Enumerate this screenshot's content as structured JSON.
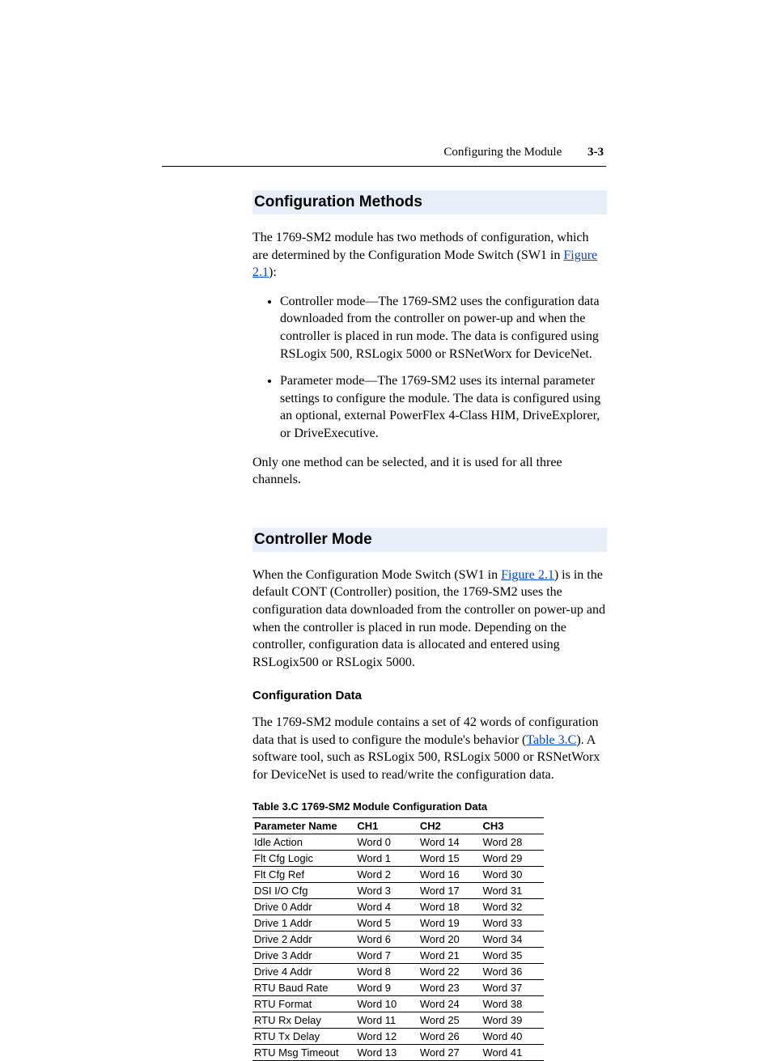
{
  "header": {
    "title": "Configuring the Module",
    "page_number": "3-3"
  },
  "section1": {
    "title": "Configuration Methods",
    "p1a": "The 1769-SM2 module has two methods of configuration, which are determined by the Configuration Mode Switch (SW1 in ",
    "p1_link": "Figure 2.1",
    "p1b": "):",
    "bullet1": "Controller mode—The 1769-SM2 uses the configuration data downloaded from the controller on power-up and when the controller is placed in run mode. The data is configured using RSLogix 500, RSLogix 5000 or RSNetWorx for DeviceNet.",
    "bullet2": "Parameter mode—The 1769-SM2 uses its internal parameter settings to configure the module. The data is configured using an optional, external PowerFlex 4-Class HIM, DriveExplorer, or DriveExecutive.",
    "p2": "Only one method can be selected, and it is used for all three channels."
  },
  "section2": {
    "title": "Controller Mode",
    "p1a": "When the Configuration Mode Switch (SW1 in ",
    "p1_link": "Figure 2.1",
    "p1b": ") is in the default CONT (Controller) position, the 1769-SM2 uses the configuration data downloaded from the controller on power-up and when the controller is placed in run mode. Depending on the controller, configuration data is allocated and entered using RSLogix500 or RSLogix 5000.",
    "sub1": {
      "title": "Configuration Data",
      "p1a": "The 1769-SM2 module contains a set of 42 words of configuration data that is used to configure the module's behavior (",
      "p1_link": "Table 3.C",
      "p1b": "). A software tool, such as RSLogix 500, RSLogix 5000 or RSNetWorx for DeviceNet is used to read/write the configuration data."
    }
  },
  "table": {
    "caption": "Table 3.C   1769-SM2 Module Configuration Data",
    "headers": [
      "Parameter Name",
      "CH1",
      "CH2",
      "CH3"
    ],
    "rows": [
      [
        "Idle Action",
        "Word 0",
        "Word 14",
        "Word 28"
      ],
      [
        "Flt Cfg Logic",
        "Word 1",
        "Word 15",
        "Word 29"
      ],
      [
        "Flt Cfg Ref",
        "Word 2",
        "Word 16",
        "Word 30"
      ],
      [
        "DSI I/O Cfg",
        "Word 3",
        "Word 17",
        "Word 31"
      ],
      [
        "Drive 0 Addr",
        "Word 4",
        "Word 18",
        "Word 32"
      ],
      [
        "Drive 1 Addr",
        "Word 5",
        "Word 19",
        "Word 33"
      ],
      [
        "Drive 2 Addr",
        "Word 6",
        "Word 20",
        "Word 34"
      ],
      [
        "Drive 3 Addr",
        "Word 7",
        "Word 21",
        "Word 35"
      ],
      [
        "Drive 4 Addr",
        "Word 8",
        "Word 22",
        "Word 36"
      ],
      [
        "RTU Baud Rate",
        "Word 9",
        "Word 23",
        "Word 37"
      ],
      [
        "RTU Format",
        "Word 10",
        "Word 24",
        "Word 38"
      ],
      [
        "RTU Rx Delay",
        "Word 11",
        "Word 25",
        "Word 39"
      ],
      [
        "RTU Tx Delay",
        "Word 12",
        "Word 26",
        "Word 40"
      ],
      [
        "RTU Msg Timeout",
        "Word 13",
        "Word 27",
        "Word 41"
      ]
    ]
  }
}
